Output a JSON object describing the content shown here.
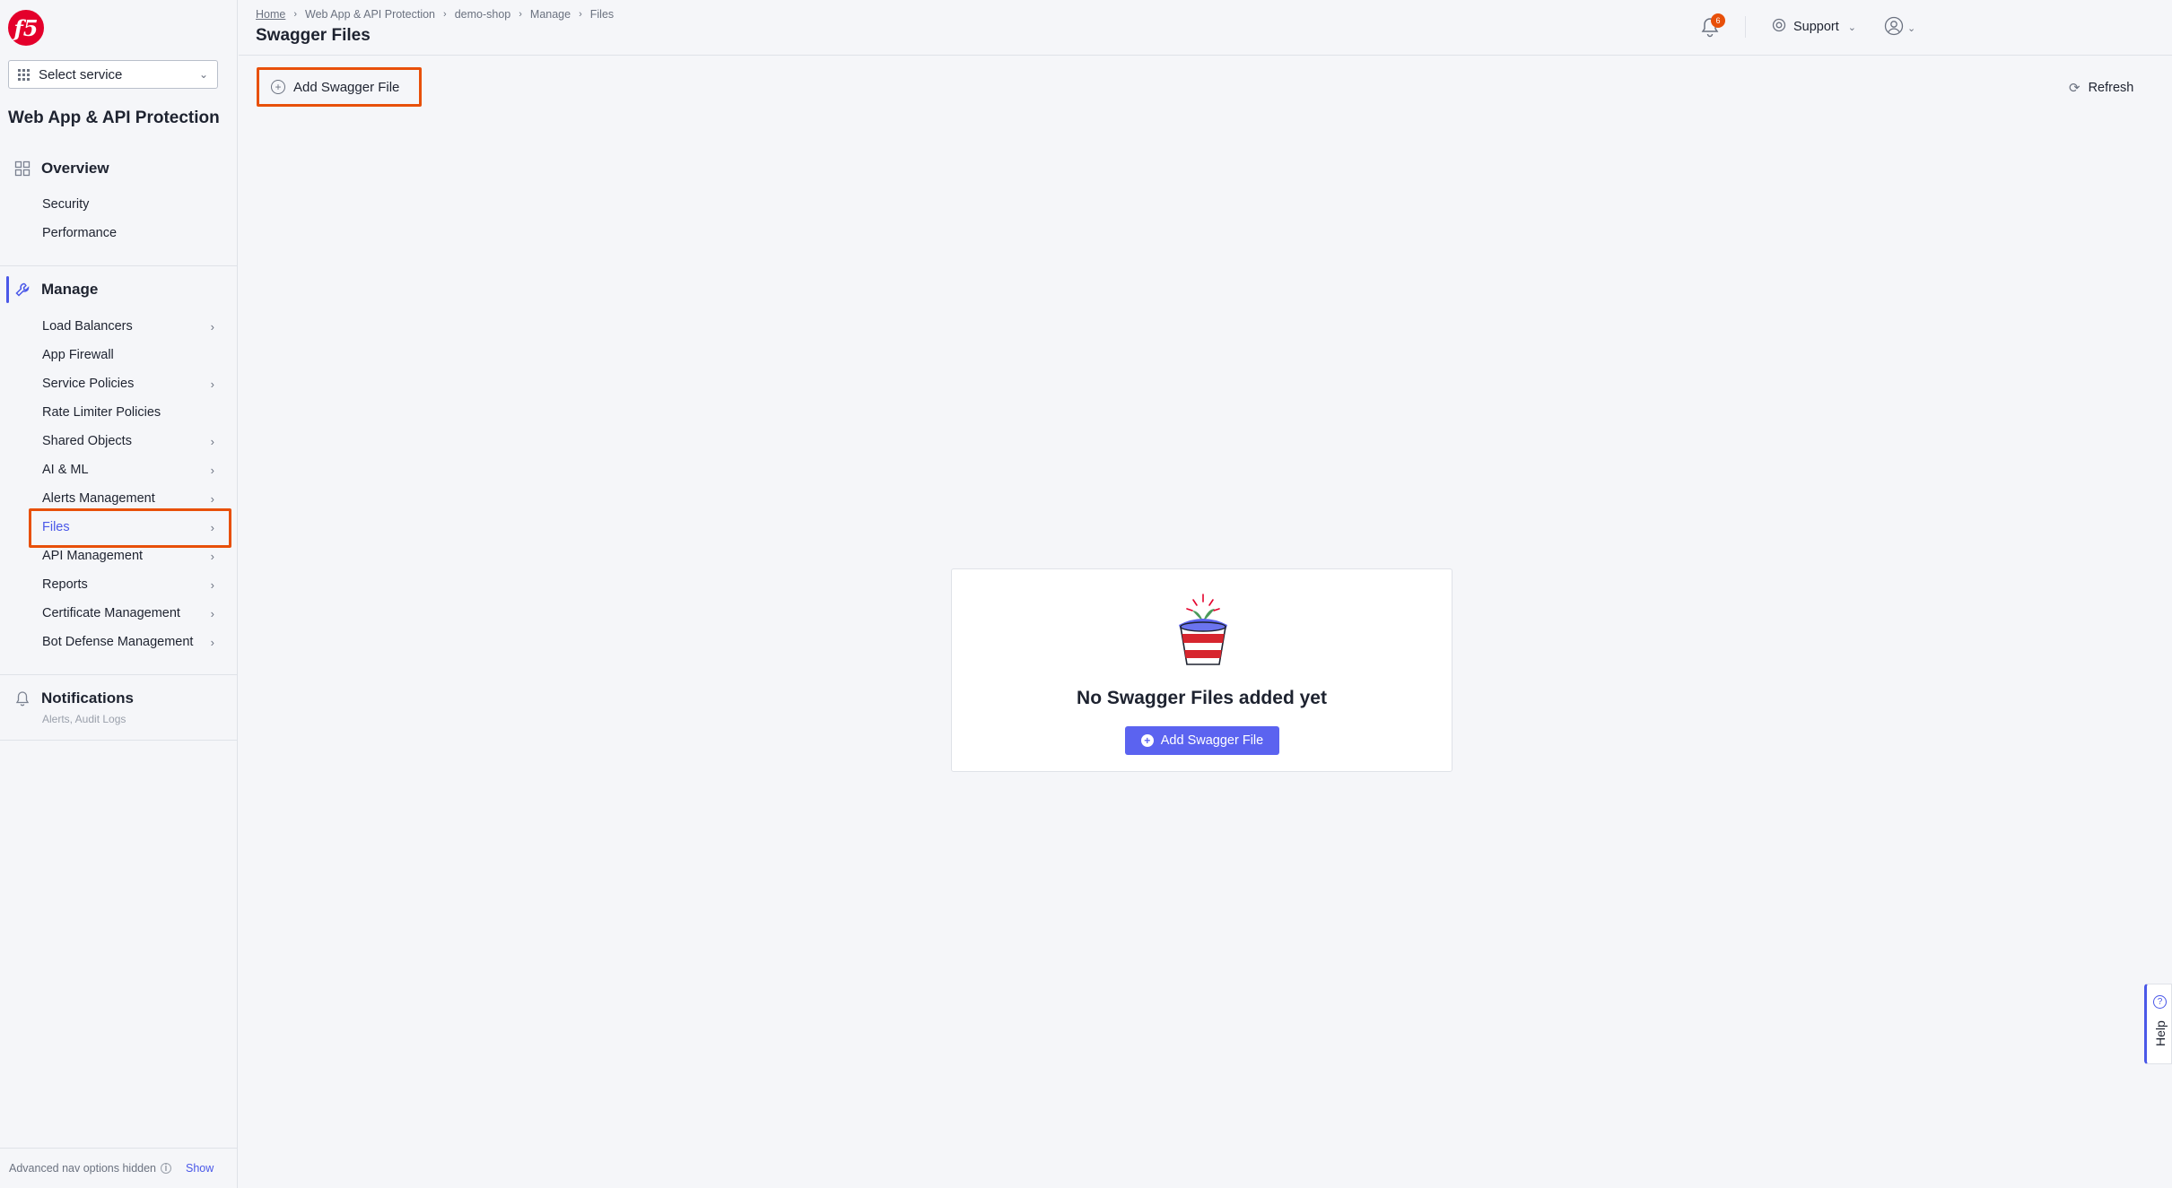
{
  "sidebar": {
    "logo_text": "f5",
    "select_service": "Select service",
    "app_title": "Web App & API Protection",
    "overview": {
      "label": "Overview",
      "items": [
        "Security",
        "Performance"
      ]
    },
    "manage": {
      "label": "Manage",
      "items": [
        {
          "label": "Load Balancers",
          "chevron": true
        },
        {
          "label": "App Firewall",
          "chevron": false
        },
        {
          "label": "Service Policies",
          "chevron": true
        },
        {
          "label": "Rate Limiter Policies",
          "chevron": false
        },
        {
          "label": "Shared Objects",
          "chevron": true
        },
        {
          "label": "AI & ML",
          "chevron": true
        },
        {
          "label": "Alerts Management",
          "chevron": true
        },
        {
          "label": "Files",
          "chevron": true,
          "active": true
        },
        {
          "label": "API Management",
          "chevron": true
        },
        {
          "label": "Reports",
          "chevron": true
        },
        {
          "label": "Certificate Management",
          "chevron": true
        },
        {
          "label": "Bot Defense Management",
          "chevron": true
        }
      ]
    },
    "notifications": {
      "label": "Notifications",
      "sub": "Alerts, Audit Logs"
    },
    "footer": {
      "text": "Advanced nav options hidden",
      "show": "Show"
    }
  },
  "header": {
    "breadcrumb": [
      "Home",
      "Web App & API Protection",
      "demo-shop",
      "Manage",
      "Files"
    ],
    "title": "Swagger Files",
    "notification_count": "6",
    "support": "Support"
  },
  "toolbar": {
    "add_label": "Add Swagger File",
    "refresh_label": "Refresh"
  },
  "empty_state": {
    "title": "No Swagger Files added yet",
    "button": "Add Swagger File"
  },
  "help": {
    "label": "Help"
  },
  "colors": {
    "accent": "#4a58e8",
    "highlight": "#e8500a",
    "primary_button": "#5b63f0",
    "brand": "#e4002b"
  }
}
